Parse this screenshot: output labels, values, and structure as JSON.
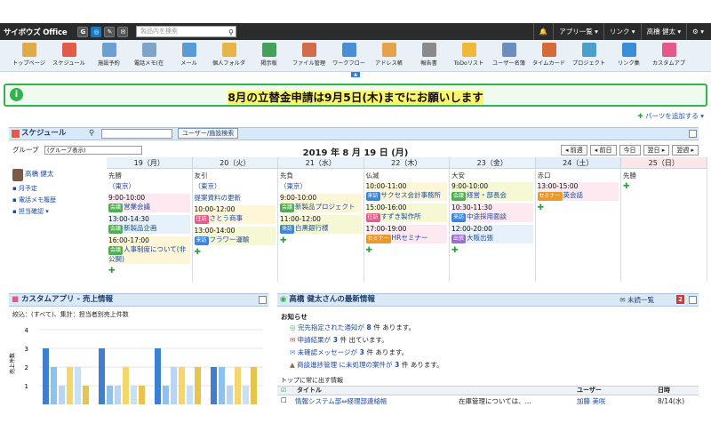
{
  "topbar": {
    "logo": "サイボウズ Office",
    "search_placeholder": "製品内を検索",
    "app_menu": "アプリ一覧 ▾",
    "link_menu": "リンク ▾",
    "user": "高橋 健太 ▾",
    "settings": "⚙ ▾"
  },
  "iconbar": [
    {
      "label": "トップページ",
      "color": "#e0a94a"
    },
    {
      "label": "スケジュール",
      "color": "#e35a4a"
    },
    {
      "label": "施設予約",
      "color": "#6aa0d6"
    },
    {
      "label": "電話メモ(在",
      "color": "#7fa4c8"
    },
    {
      "label": "メール",
      "color": "#5b9bd5"
    },
    {
      "label": "個人フォルダ",
      "color": "#e8b44a"
    },
    {
      "label": "掲示板",
      "color": "#45a05a"
    },
    {
      "label": "ファイル管理",
      "color": "#d46b4a"
    },
    {
      "label": "ワークフロー",
      "color": "#4a8fd6"
    },
    {
      "label": "アドレス帳",
      "color": "#e6a24a"
    },
    {
      "label": "報告書",
      "color": "#8a8a8a"
    },
    {
      "label": "ToDoリスト",
      "color": "#f0b83a"
    },
    {
      "label": "ユーザー名簿",
      "color": "#6a8fbf"
    },
    {
      "label": "タイムカード",
      "color": "#d66b3a"
    },
    {
      "label": "プロジェクト",
      "color": "#4aa0c8"
    },
    {
      "label": "リンク集",
      "color": "#3a8fd6"
    },
    {
      "label": "カスタムアプ",
      "color": "#e35a8a"
    }
  ],
  "notice": {
    "message": "8月の立替金申請は9月5日(木)までにお願いします"
  },
  "add_parts": "パーツを追加する ▾",
  "schedule": {
    "title": "スケジュール",
    "user_facility_button": "ユーザー/施設検索",
    "group_label": "グループ",
    "group_select": "(グループ表示)",
    "date": "2019 年 8 月 19 日 (月)",
    "nav": [
      "◂ 前週",
      "◂ 前日",
      "今日",
      "翌日 ▸",
      "翌週 ▸"
    ],
    "user_name": "高橋 健太",
    "user_links": [
      "月予定",
      "電話メモ履歴",
      "担当確認 ▾"
    ],
    "days": [
      {
        "label": "19（月）",
        "rokuyo": "先勝",
        "events": [
          {
            "time": "",
            "tag": "",
            "text": "（東京）"
          },
          {
            "time": "9:00-10:00",
            "tag": "会議",
            "text": "営業会議"
          },
          {
            "time": "13:00-14:30",
            "tag": "会議",
            "text": "新製品企画"
          },
          {
            "time": "16:00-17:00",
            "tag": "会議",
            "text": "人事制度について(非公開)"
          }
        ]
      },
      {
        "label": "20（火）",
        "rokuyo": "友引",
        "events": [
          {
            "time": "",
            "tag": "",
            "text": "（東京）"
          },
          {
            "time": "",
            "tag": "",
            "text": "提案資料の更新"
          },
          {
            "time": "10:00-12:00",
            "tag": "往訪",
            "text": "さとう商事"
          },
          {
            "time": "13:00-14:00",
            "tag": "来訪",
            "text": "フラワー運輸"
          }
        ]
      },
      {
        "label": "21（水）",
        "rokuyo": "先負",
        "events": [
          {
            "time": "",
            "tag": "",
            "text": "（東京）"
          },
          {
            "time": "9:00-10:00",
            "tag": "会議",
            "text": "新製品プロジェクト"
          },
          {
            "time": "11:00-12:00",
            "tag": "来訪",
            "text": "白黒銀行様"
          }
        ]
      },
      {
        "label": "22（木）",
        "rokuyo": "仏滅",
        "events": [
          {
            "time": "10:00-11:00",
            "tag": "来訪",
            "text": "サクセス会計事務所"
          },
          {
            "time": "15:00-16:00",
            "tag": "往訪",
            "text": "すずき製作所"
          },
          {
            "time": "17:00-19:00",
            "tag": "セミナー",
            "text": "HRセミナー"
          }
        ]
      },
      {
        "label": "23（金）",
        "rokuyo": "大安",
        "events": [
          {
            "time": "9:00-10:00",
            "tag": "会議",
            "text": "経営・部長会"
          },
          {
            "time": "10:30-11:30",
            "tag": "来訪",
            "text": "中途採用面談"
          },
          {
            "time": "12:00-20:00",
            "tag": "出張",
            "text": "大阪出張"
          }
        ]
      },
      {
        "label": "24（土）",
        "rokuyo": "赤口",
        "events": [
          {
            "time": "13:00-15:00",
            "tag": "セミナー",
            "text": "英会話"
          }
        ]
      },
      {
        "label": "25（日）",
        "rokuyo": "先勝",
        "events": []
      }
    ]
  },
  "custom_app": {
    "title": "カスタムアプリ - 売上情報",
    "caption": "絞込：(すべて)、集計：担当者別売上件数"
  },
  "chart_data": {
    "type": "bar",
    "title": "",
    "xlabel": "",
    "ylabel": "売上件数",
    "ylim": [
      0,
      4
    ],
    "yticks": [
      1,
      2,
      3,
      4
    ],
    "series": [
      {
        "values": [
          3,
          3,
          3,
          2
        ]
      },
      {
        "values": [
          2,
          1,
          1,
          2
        ]
      },
      {
        "values": [
          1,
          1,
          2,
          1
        ]
      },
      {
        "values": [
          2,
          2,
          2,
          2
        ]
      },
      {
        "values": [
          2,
          1,
          1,
          1
        ]
      },
      {
        "values": [
          1,
          1,
          2,
          2
        ]
      }
    ]
  },
  "news": {
    "title": "高橋 健太さんの最新情報",
    "unread": "未読一覧",
    "badge": "2",
    "section": "お知らせ",
    "items": [
      {
        "text_a": "完先指定された通知が",
        "count": "8",
        "text_b": "件 あります。"
      },
      {
        "text_a": "申請結果が",
        "count": "3",
        "text_b": "件 出ています。"
      },
      {
        "text_a": "未確認メッセージが",
        "count": "3",
        "text_b": "件 あります。"
      },
      {
        "text_a": "商談進捗管理 に未処理の案件が",
        "count": "3",
        "text_b": "件 あります。"
      }
    ],
    "top_label": "トップに常に出す情報",
    "headers": [
      "タイトル",
      "ユーザー",
      "日時"
    ],
    "row": {
      "title": "情報システム部⇔経理部連絡帳",
      "summary": "在庫管理については、...",
      "user": "加藤 美咲",
      "date": "8/14(水)"
    }
  }
}
